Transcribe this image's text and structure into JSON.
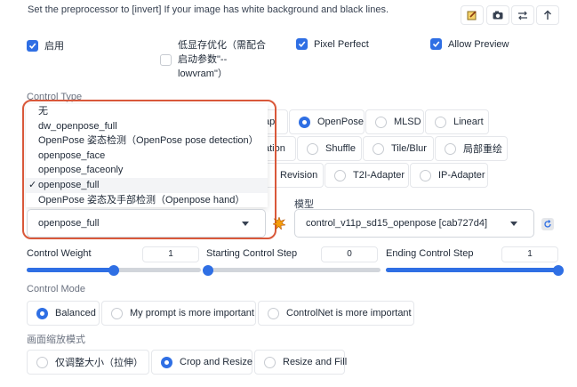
{
  "hint": "Set the preprocessor to [invert] If your image has white background and black lines.",
  "toolbar": {
    "icons": [
      "pencil-icon",
      "camera-icon",
      "swap-icon",
      "upload-arrow-icon"
    ]
  },
  "options": {
    "enable": {
      "label": "启用",
      "checked": true
    },
    "low_vram": {
      "label": "低显存优化（需配合启动参数\"--lowvram\"）",
      "line1": "低显存优化（需配合",
      "line2": "启动参数\"--",
      "line3": "lowvram\"）",
      "checked": false
    },
    "pixel_perfect": {
      "label": "Pixel Perfect",
      "checked": true
    },
    "allow_preview": {
      "label": "Allow Preview",
      "checked": true
    }
  },
  "control_type": {
    "label": "Control Type",
    "visible_options": [
      {
        "label": "ap",
        "selected": false
      },
      {
        "label": "OpenPose",
        "selected": true
      },
      {
        "label": "MLSD",
        "selected": false
      },
      {
        "label": "Lineart",
        "selected": false
      },
      {
        "label": "ation",
        "selected": false
      },
      {
        "label": "Shuffle",
        "selected": false
      },
      {
        "label": "Tile/Blur",
        "selected": false
      },
      {
        "label": "局部重绘",
        "selected": false
      },
      {
        "label": "Revision",
        "selected": false
      },
      {
        "label": "T2I-Adapter",
        "selected": false
      },
      {
        "label": "IP-Adapter",
        "selected": false
      }
    ]
  },
  "preprocessor": {
    "options": [
      "无",
      "dw_openpose_full",
      "OpenPose 姿态检测（OpenPose pose detection）",
      "openpose_face",
      "openpose_faceonly",
      "openpose_full",
      "OpenPose 姿态及手部检测（Openpose hand）"
    ],
    "selected": "openpose_full",
    "check_mark": "✓"
  },
  "model": {
    "label": "模型",
    "selected": "control_v11p_sd15_openpose [cab727d4]"
  },
  "sliders": {
    "control_weight": {
      "label": "Control Weight",
      "value": "1",
      "fraction": 0.5
    },
    "starting_step": {
      "label": "Starting Control Step",
      "value": "0",
      "fraction": 0.0
    },
    "ending_step": {
      "label": "Ending Control Step",
      "value": "1",
      "fraction": 1.0
    }
  },
  "control_mode": {
    "label": "Control Mode",
    "options": [
      {
        "label": "Balanced",
        "selected": true
      },
      {
        "label": "My prompt is more important",
        "selected": false
      },
      {
        "label": "ControlNet is more important",
        "selected": false
      }
    ]
  },
  "resize_mode": {
    "label": "画面缩放模式",
    "options": [
      {
        "label": "仅调整大小（拉伸）",
        "selected": false
      },
      {
        "label": "Crop and Resize",
        "selected": true
      },
      {
        "label": "Resize and Fill",
        "selected": false
      }
    ]
  },
  "colors": {
    "accent": "#2f6fe4",
    "highlight": "#d9583a"
  }
}
